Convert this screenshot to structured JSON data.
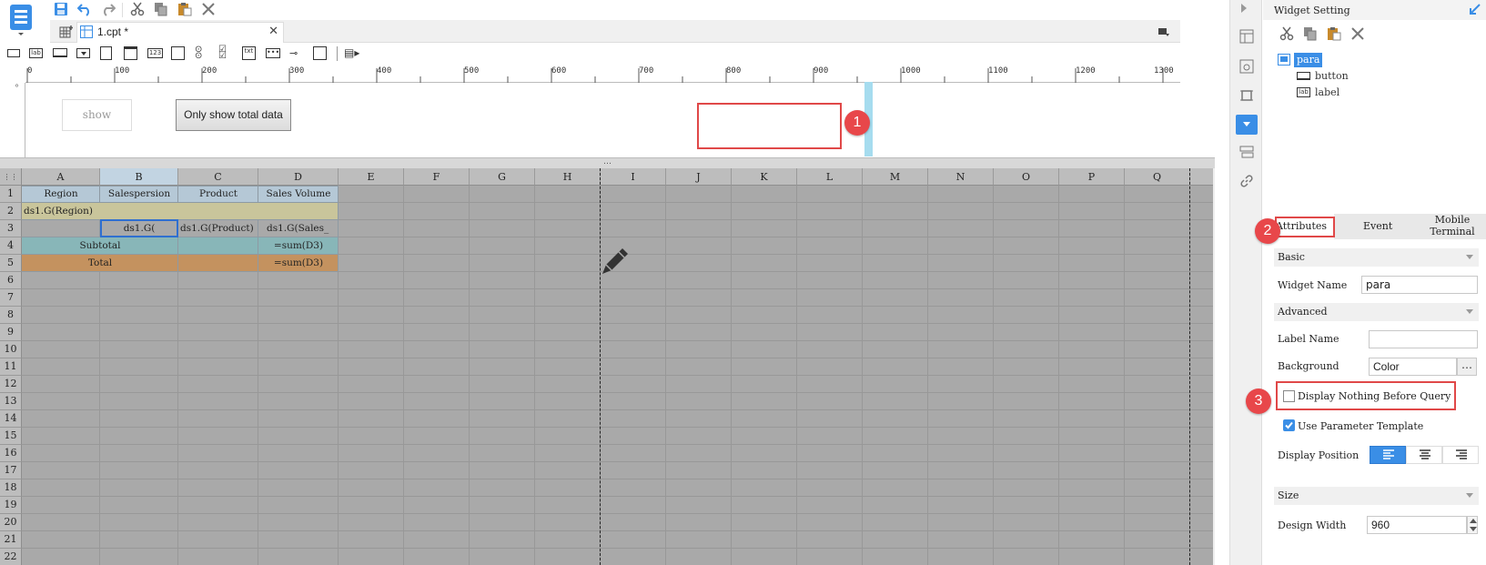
{
  "file_tab": {
    "label": "1.cpt *"
  },
  "ruler": {
    "ticks": [
      "0",
      "100",
      "200",
      "300",
      "400",
      "500",
      "600",
      "700",
      "800",
      "900",
      "1000",
      "1100",
      "1200",
      "1300"
    ]
  },
  "param_pane": {
    "show_label": "show",
    "button_label": "Only show total data"
  },
  "columns": [
    "A",
    "B",
    "C",
    "D",
    "E",
    "F",
    "G",
    "H",
    "I",
    "J",
    "K",
    "L",
    "M",
    "N",
    "O",
    "P",
    "Q"
  ],
  "rows": [
    "1",
    "2",
    "3",
    "4",
    "5",
    "6",
    "7",
    "8",
    "9",
    "10",
    "11",
    "12",
    "13",
    "14",
    "15",
    "16",
    "17",
    "18",
    "19",
    "20",
    "21",
    "22"
  ],
  "cells": {
    "a1": "Region",
    "b1": "Salespersion",
    "c1": "Product",
    "d1": "Sales Volume",
    "a2": "ds1.G(Region)",
    "b3": "ds1.G(",
    "c3": "ds1.G(Product)",
    "d3": "ds1.G(Sales_",
    "a4": "Subtotal",
    "d4": "=sum(D3)",
    "a5": "Total",
    "d5": "=sum(D3)"
  },
  "widget_setting": {
    "title": "Widget Setting",
    "tree": [
      {
        "label": "para",
        "selected": true
      },
      {
        "label": "button",
        "selected": false
      },
      {
        "label": "label",
        "selected": false
      }
    ],
    "tabs": [
      "Attributes",
      "Event",
      "Mobile Terminal"
    ],
    "sections": {
      "basic": "Basic",
      "advanced": "Advanced",
      "size": "Size"
    },
    "widget_name_label": "Widget Name",
    "widget_name_value": "para",
    "label_name_label": "Label Name",
    "label_name_value": "",
    "background_label": "Background",
    "background_value": "Color",
    "display_nothing_label": "Display Nothing Before Query",
    "display_nothing_checked": false,
    "use_template_label": "Use Parameter Template",
    "use_template_checked": true,
    "display_position_label": "Display Position",
    "design_width_label": "Design Width",
    "design_width_value": "960"
  },
  "badges": [
    "1",
    "2",
    "3"
  ],
  "colors": {
    "accent": "#3a8ee6",
    "header_row_bg": "#b5c8d6",
    "region_row_bg": "#c9c59b",
    "subtotal_row_bg": "#88b6b8",
    "total_row_bg": "#c4925f",
    "annotation_red": "#e8474a",
    "grid_bg": "#a9a9a9"
  }
}
